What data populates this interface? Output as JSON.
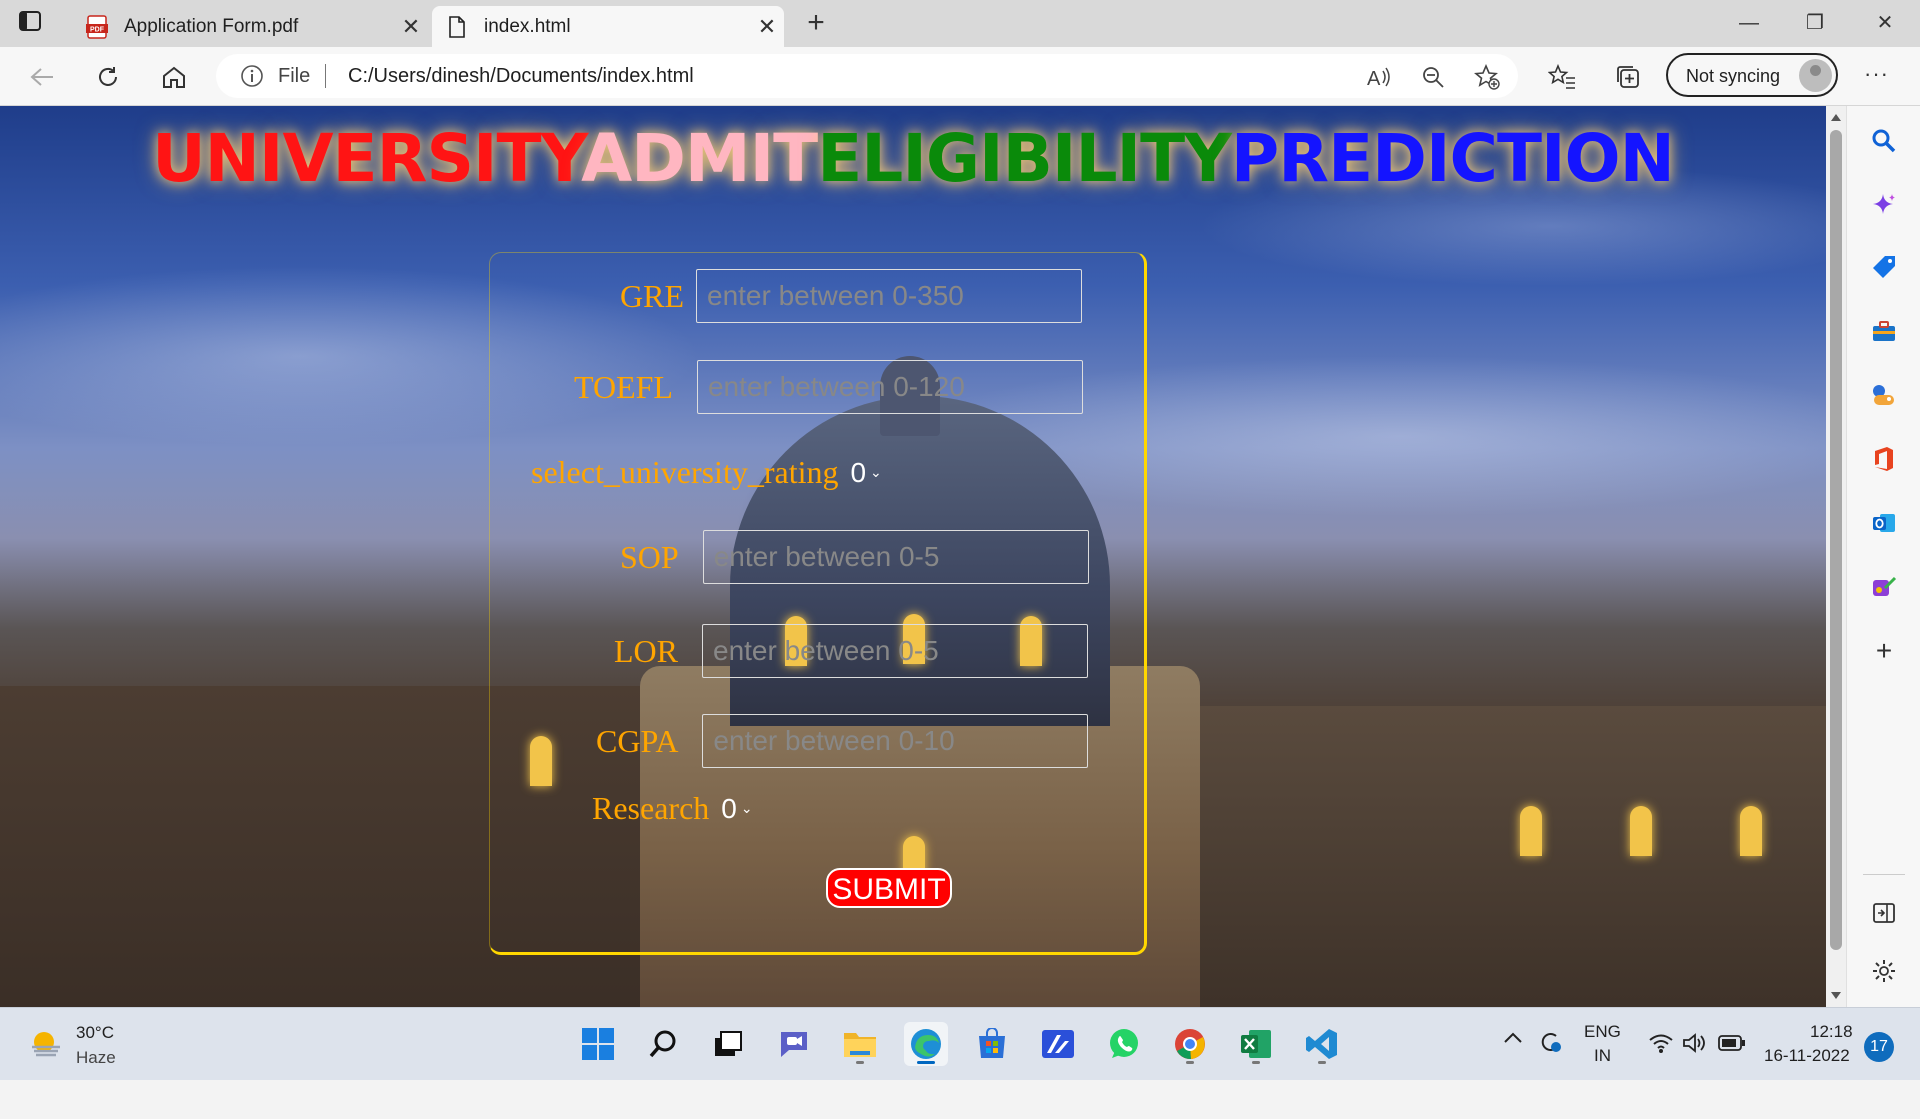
{
  "browser": {
    "tabs": [
      {
        "title": "Application Form.pdf",
        "active": false,
        "icon": "pdf-icon"
      },
      {
        "title": "index.html",
        "active": true,
        "icon": "file-icon"
      }
    ],
    "address": {
      "scheme_label": "File",
      "url": "C:/Users/dinesh/Documents/index.html"
    },
    "profile": {
      "label": "Not syncing"
    }
  },
  "page": {
    "headline": {
      "part1": "UNIVERSITY",
      "part2": "ADMIT",
      "part3": "ELIGIBILITY",
      "part4": "PREDICTION",
      "colors": {
        "part1": "#ff1414",
        "part2": "#ffb6c1",
        "part3": "#0a8a0a",
        "part4": "#1414ff"
      }
    },
    "form": {
      "gre": {
        "label": "GRE",
        "placeholder": "enter between 0-350"
      },
      "toefl": {
        "label": "TOEFL",
        "placeholder": "enter between 0-120"
      },
      "rating": {
        "label": "select_university_rating",
        "value": "0"
      },
      "sop": {
        "label": "SOP",
        "placeholder": "enter between 0-5"
      },
      "lor": {
        "label": "LOR",
        "placeholder": "enter between 0-5"
      },
      "cgpa": {
        "label": "CGPA",
        "placeholder": "enter between 0-10"
      },
      "research": {
        "label": "Research",
        "value": "0"
      },
      "submit_label": "SUBMIT",
      "label_color": "#ffa500",
      "border_color": "#ffd700"
    }
  },
  "taskbar": {
    "weather": {
      "temp": "30°C",
      "condition": "Haze"
    },
    "language": {
      "lang": "ENG",
      "region": "IN"
    },
    "clock": {
      "time": "12:18",
      "date": "16-11-2022"
    },
    "notifications": "17"
  }
}
